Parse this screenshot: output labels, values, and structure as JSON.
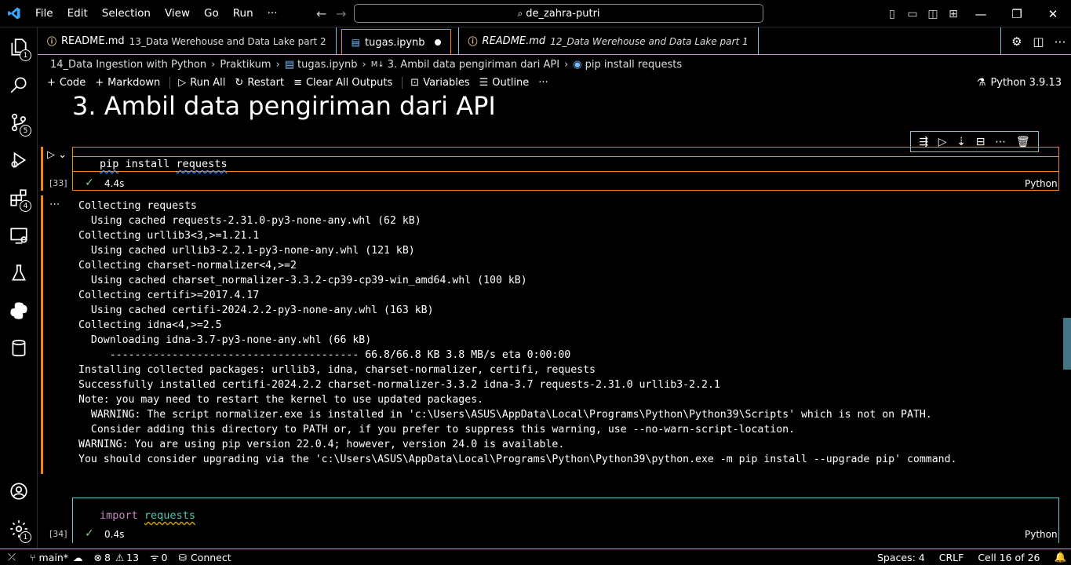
{
  "titlebar": {
    "menu": [
      "File",
      "Edit",
      "Selection",
      "View",
      "Go",
      "Run",
      "···"
    ],
    "search": "de_zahra-putri"
  },
  "activity": {
    "explorer_badge": "1",
    "scm_badge": "5",
    "extensions_badge": "4",
    "settings_badge": "1"
  },
  "tabs": [
    {
      "label": "README.md",
      "desc": "13_Data Werehouse and Data Lake part 2"
    },
    {
      "label": "tugas.ipynb",
      "desc": ""
    },
    {
      "label": "README.md",
      "desc": "12_Data Werehouse and Data Lake part 1"
    }
  ],
  "breadcrumb": [
    "14_Data Ingestion with Python",
    "Praktikum",
    "tugas.ipynb",
    "3. Ambil data pengiriman dari API",
    "pip install requests"
  ],
  "nbtoolbar": {
    "code": "Code",
    "markdown": "Markdown",
    "run_all": "Run All",
    "restart": "Restart",
    "clear": "Clear All Outputs",
    "variables": "Variables",
    "outline": "Outline",
    "more": "···",
    "kernel": "Python 3.9.13"
  },
  "heading": "3. Ambil data pengiriman dari API",
  "cell33": {
    "exec": "[33]",
    "code_cmd": "pip",
    "code_rest1": " install ",
    "code_arg": "requests",
    "time": "4.4s",
    "lang": "Python"
  },
  "output_lines": [
    "Collecting requests",
    "  Using cached requests-2.31.0-py3-none-any.whl (62 kB)",
    "Collecting urllib3<3,>=1.21.1",
    "  Using cached urllib3-2.2.1-py3-none-any.whl (121 kB)",
    "Collecting charset-normalizer<4,>=2",
    "  Using cached charset_normalizer-3.3.2-cp39-cp39-win_amd64.whl (100 kB)",
    "Collecting certifi>=2017.4.17",
    "  Using cached certifi-2024.2.2-py3-none-any.whl (163 kB)",
    "Collecting idna<4,>=2.5",
    "  Downloading idna-3.7-py3-none-any.whl (66 kB)",
    "     ---------------------------------------- 66.8/66.8 KB 3.8 MB/s eta 0:00:00",
    "Installing collected packages: urllib3, idna, charset-normalizer, certifi, requests",
    "Successfully installed certifi-2024.2.2 charset-normalizer-3.3.2 idna-3.7 requests-2.31.0 urllib3-2.2.1",
    "Note: you may need to restart the kernel to use updated packages.",
    "  WARNING: The script normalizer.exe is installed in 'c:\\Users\\ASUS\\AppData\\Local\\Programs\\Python\\Python39\\Scripts' which is not on PATH.",
    "  Consider adding this directory to PATH or, if you prefer to suppress this warning, use --no-warn-script-location.",
    "WARNING: You are using pip version 22.0.4; however, version 24.0 is available.",
    "You should consider upgrading via the 'c:\\Users\\ASUS\\AppData\\Local\\Programs\\Python\\Python39\\python.exe -m pip install --upgrade pip' command."
  ],
  "output_more": "···",
  "cell34": {
    "exec": "[34]",
    "kw": "import",
    "mod": "requests",
    "time": "0.4s",
    "lang": "Python"
  },
  "statusbar": {
    "branch": "main*",
    "errors": "8",
    "warnings": "13",
    "ports": "0",
    "connect": "Connect",
    "spaces": "Spaces: 4",
    "eol": "CRLF",
    "cell": "Cell 16 of 26"
  },
  "colors": {
    "accent_orange": "#f38518",
    "accent_cyan": "#6fc3df",
    "check_green": "#89d185"
  }
}
